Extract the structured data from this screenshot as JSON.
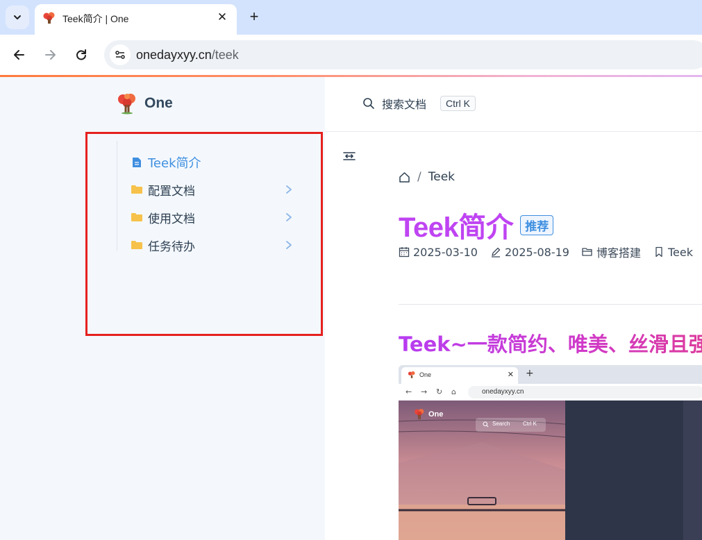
{
  "browser": {
    "tab_title": "Teek简介 | One",
    "url_domain": "onedayxyy.cn",
    "url_path": "/teek"
  },
  "site": {
    "name": "One",
    "search_label": "搜索文档",
    "search_shortcut": "Ctrl K"
  },
  "sidebar": {
    "items": [
      {
        "label": "Teek简介",
        "icon": "document-icon",
        "active": true
      },
      {
        "label": "配置文档",
        "icon": "folder-icon",
        "expandable": true
      },
      {
        "label": "使用文档",
        "icon": "folder-icon",
        "expandable": true
      },
      {
        "label": "任务待办",
        "icon": "folder-icon",
        "expandable": true
      }
    ]
  },
  "article": {
    "breadcrumb": [
      "Teek"
    ],
    "title": "Teek简介",
    "badge": "推荐",
    "meta": {
      "created": "2025-03-10",
      "updated": "2025-08-19",
      "category": "博客搭建",
      "tag": "Teek"
    },
    "subtitle": "Teek~一款简约、唯美、丝滑且强"
  },
  "preview": {
    "tab_title": "One",
    "url": "onedayxyy.cn",
    "brand": "One",
    "search_label": "Search",
    "search_shortcut": "Ctrl K"
  },
  "colors": {
    "accent": "#3f8fe0",
    "title": "#bf44f2",
    "highlight": "#e5201e"
  }
}
